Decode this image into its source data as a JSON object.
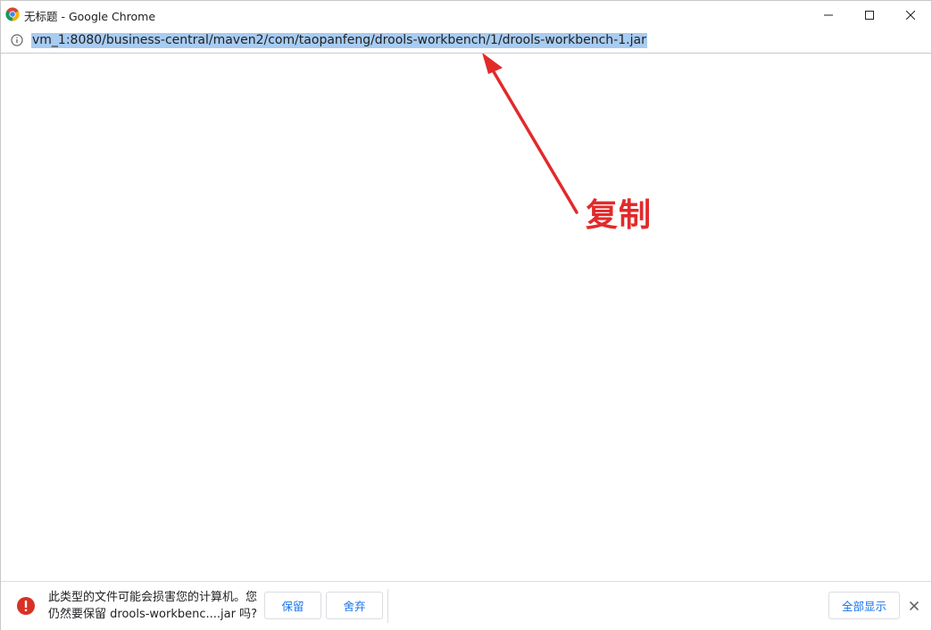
{
  "window": {
    "title": "无标题 - Google Chrome"
  },
  "addressbar": {
    "url": "vm_1:8080/business-central/maven2/com/taopanfeng/drools-workbench/1/drools-workbench-1.jar"
  },
  "annotation": {
    "label": "复制",
    "color": "#e22a2a"
  },
  "download_bar": {
    "warning_line1": "此类型的文件可能会损害您的计算机。您",
    "warning_line2": "仍然要保留 drools-workbenc....jar 吗?",
    "keep_label": "保留",
    "discard_label": "舍弃",
    "show_all_label": "全部显示",
    "accent_color": "#1a73e8",
    "warning_color": "#d93025"
  }
}
